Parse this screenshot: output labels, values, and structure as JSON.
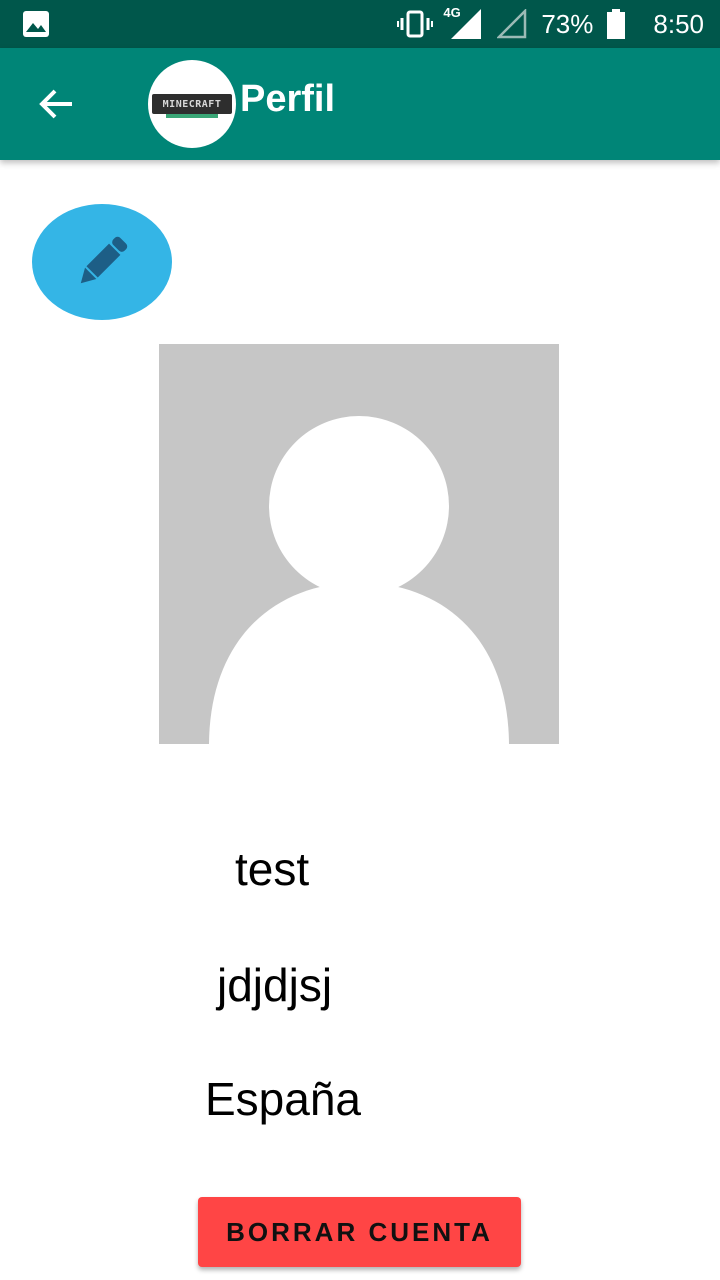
{
  "status_bar": {
    "network": "4G",
    "battery": "73%",
    "time": "8:50",
    "icons": [
      "image-icon",
      "vibrate-icon",
      "signal-icon",
      "signal-empty-icon",
      "battery-icon"
    ]
  },
  "app_bar": {
    "title": "Perfil",
    "logo_text": "MINECRAFT",
    "back_icon": "arrow-left-icon",
    "color": "#008577"
  },
  "edit_button": {
    "icon": "pencil-icon",
    "color": "#34b5e6"
  },
  "profile": {
    "name": "test",
    "username": "jdjdjsj",
    "country": "España"
  },
  "delete_button": {
    "label": "BORRAR CUENTA",
    "color": "#ff4545"
  }
}
